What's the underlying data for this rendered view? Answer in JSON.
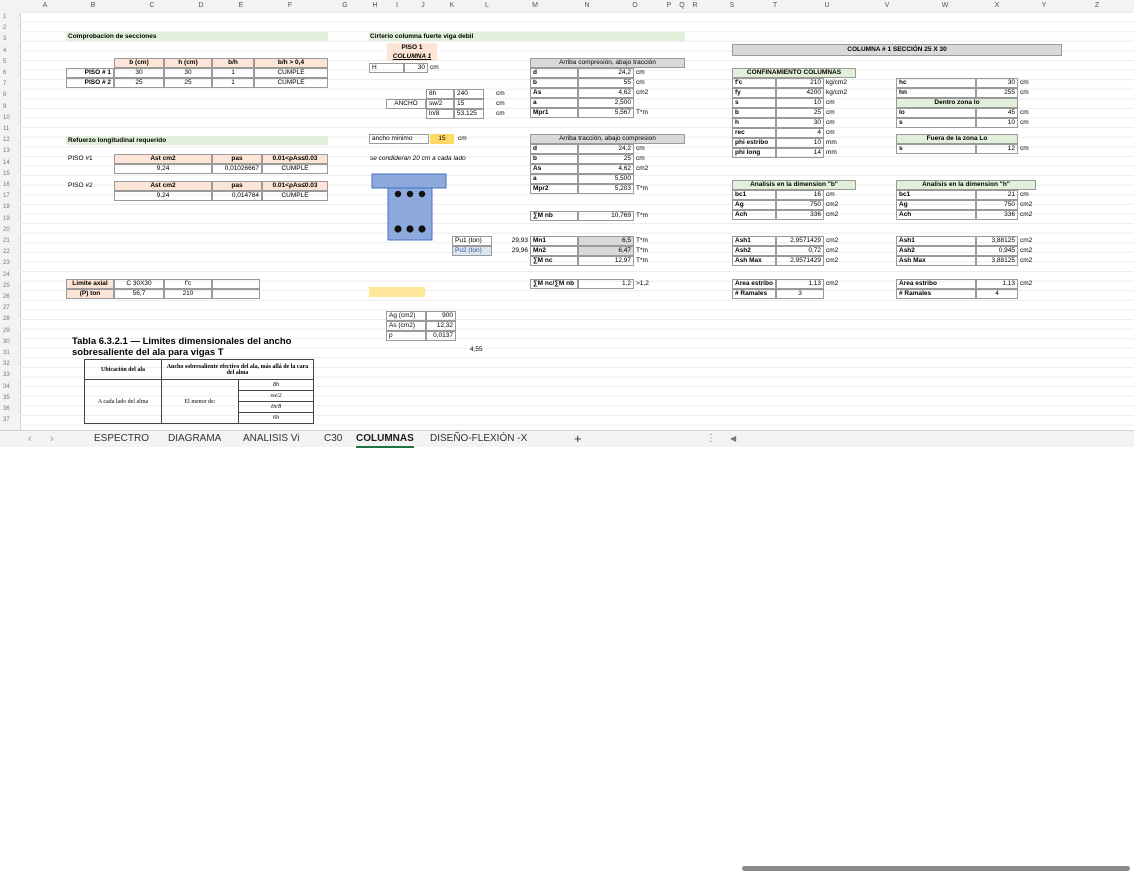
{
  "columns": [
    "A",
    "B",
    "C",
    "D",
    "E",
    "F",
    "G",
    "H",
    "I",
    "J",
    "K",
    "L",
    "M",
    "N",
    "O",
    "P",
    "Q",
    "R",
    "S",
    "T",
    "U",
    "V",
    "W",
    "X",
    "Y",
    "Z"
  ],
  "rows": [
    "1",
    "2",
    "3",
    "4",
    "5",
    "6",
    "7",
    "8",
    "9",
    "10",
    "11",
    "12",
    "13",
    "14",
    "15",
    "16",
    "17",
    "18",
    "19",
    "20",
    "21",
    "22",
    "23",
    "24",
    "25",
    "26",
    "27",
    "28",
    "29",
    "30",
    "31",
    "32",
    "33",
    "34",
    "35",
    "36",
    "37"
  ],
  "sec": {
    "title": "Comprobacion de secciones",
    "headers": [
      "b (cm)",
      "h (cm)",
      "b/h",
      "b/h > 0,4"
    ],
    "rows": [
      {
        "label": "PISO # 1",
        "b": "30",
        "h": "30",
        "bh": "1",
        "check": "CUMPLE"
      },
      {
        "label": "PISO # 2",
        "b": "25",
        "h": "25",
        "bh": "1",
        "check": "CUMPLE"
      }
    ]
  },
  "long": {
    "title": "Refuerzo longitudinal requerido",
    "p1": "PISO #1",
    "p2": "PISO #2",
    "h_ast": "Ast cm2",
    "h_pas": "pas",
    "h_range": "0.01<ρAs≤0.03",
    "ast1": "9,24",
    "pas1": "0,01026667",
    "c1": "CUMPLE",
    "ast2": "9,24",
    "pas2": "0,014784",
    "c2": "CUMPLE"
  },
  "axial": {
    "l1": "Limite axial",
    "l2": "(P) ton",
    "c30": "C 30X30",
    "fc": "f'c",
    "v1": "56,7",
    "v2": "210"
  },
  "crit": {
    "title": "Cirterio columna fuerte viga debil",
    "piso": "PISO 1",
    "col": "COLUMNA 1",
    "h": "H",
    "hv": "30",
    "hu": "cm",
    "eight": "8h",
    "eightv": "240",
    "eightu": "cm",
    "ancho": "ANCHO",
    "sw": "sw/2",
    "swv": "15",
    "swu": "cm",
    "ln": "ln/8",
    "lnv": "53,125",
    "lnu": "cm",
    "amin": "ancho minimo",
    "aminv": "15",
    "aminu": "cm",
    "note": "se condideran 20 cm a cada lado",
    "pu1": "Pu1 (ton)",
    "pu1v": "29,93",
    "pu2": "Pu2 (ton)",
    "pu2v": "29,96",
    "ag": "Ag (cm2)",
    "agv": "900",
    "asc": "As (cm2)",
    "ascv": "12,32",
    "rho": "p",
    "rhov": "0,0137",
    "extra": "4,55"
  },
  "mom": {
    "h1": "Arriba compresión, abajo tracción",
    "r1": [
      [
        "d",
        "24,2",
        "cm"
      ],
      [
        "b",
        "55",
        "cm"
      ],
      [
        "As",
        "4,62",
        "cm2"
      ],
      [
        "a",
        "2,500",
        ""
      ],
      [
        "Mpr1",
        "5,567",
        "T*m"
      ]
    ],
    "h2": "Arriba tracción, abajo compresion",
    "r2": [
      [
        "d",
        "24,2",
        "cm"
      ],
      [
        "b",
        "25",
        "cm"
      ],
      [
        "As",
        "4,62",
        "cm2"
      ],
      [
        "a",
        "5,500",
        ""
      ],
      [
        "Mpr2",
        "5,203",
        "T*m"
      ]
    ],
    "mnb": "∑M nb",
    "mnbv": "10,769",
    "mnbu": "T*m",
    "mn1": "Mn1",
    "mn1v": "6,5",
    "mn2": "Mn2",
    "mn2v": "6,47",
    "mnc": "∑M nc",
    "mncv": "12,97",
    "tm": "T*m",
    "ratio": "∑M nc/∑M nb",
    "ratiov": "1,2",
    ">12": ">1,2"
  },
  "col": {
    "title": "COLUMNA # 1   SECCIÓN 25 X 30",
    "conf": "CONFINAMIENTO COLUMNAS",
    "c_rows": [
      [
        "f'c",
        "210",
        "kg/cm2"
      ],
      [
        "fy",
        "4200",
        "kg/cm2"
      ],
      [
        "s",
        "10",
        "cm"
      ],
      [
        "b",
        "25",
        "cm"
      ],
      [
        "h",
        "30",
        "cm"
      ],
      [
        "rec",
        "4",
        "cm"
      ],
      [
        "phi estribo",
        "10",
        "mm"
      ],
      [
        "phi long",
        "14",
        "mm"
      ]
    ],
    "hc": "hc",
    "hcv": "30",
    "hcu": "cm",
    "hn": "hn",
    "hnv": "255",
    "hnu": "cm",
    "dz": "Dentro zona lo",
    "lo": "lo",
    "lov": "45",
    "lou": "cm",
    "s2": "s",
    "s2v": "10",
    "s2u": "cm",
    "fz": "Fuera de la zona Lo",
    "s3": "s",
    "s3v": "12",
    "s3u": "cm",
    "ab": "Analisis en la dimension \"b\"",
    "ah": "Analisis en la dimension \"h\"",
    "b_rows": [
      [
        "bc1",
        "16",
        "cm"
      ],
      [
        "Ag",
        "750",
        "cm2"
      ],
      [
        "Ach",
        "336",
        "cm2"
      ]
    ],
    "h_rows": [
      [
        "bc1",
        "21",
        "cm"
      ],
      [
        "Ag",
        "750",
        "cm2"
      ],
      [
        "Ach",
        "336",
        "cm2"
      ]
    ],
    "ashb": [
      [
        "Ash1",
        "2,9571429",
        "cm2"
      ],
      [
        "Ash2",
        "0,72",
        "cm2"
      ],
      [
        "Ash Max",
        "2,9571429",
        "cm2"
      ]
    ],
    "ashh": [
      [
        "Ash1",
        "3,88125",
        "cm2"
      ],
      [
        "Ash2",
        "0,945",
        "cm2"
      ],
      [
        "Ash Max",
        "3,88125",
        "cm2"
      ]
    ],
    "aeb": "Area estribo",
    "aebv": "1,13",
    "aebu": "cm2",
    "rb": "# Ramales",
    "rbv": "3",
    "aeh": "Area estribo",
    "aehv": "1,13",
    "aehu": "cm2",
    "rh": "# Ramales",
    "rhv": "4"
  },
  "table632": {
    "title1": "Tabla 6.3.2.1 — Limites dimensionales del ancho",
    "title2": "sobresaliente del ala para vigas T",
    "h1": "Ubicación del ala",
    "h2": "Ancho sobresaliente efectivo del ala, más allá de la cara del alma",
    "row1": "A cada lado del alma",
    "row1b": "El menor de:",
    "v1": "8h",
    "v2": "sw/2",
    "v3": "ℓn/8",
    "v4": "6h"
  },
  "tabs": [
    "ESPECTRO",
    "DIAGRAMA",
    "ANALISIS Vi",
    "C30",
    "COLUMNAS",
    "DISEÑO-FLEXIÓN -X",
    "+"
  ],
  "active_tab": "COLUMNAS"
}
